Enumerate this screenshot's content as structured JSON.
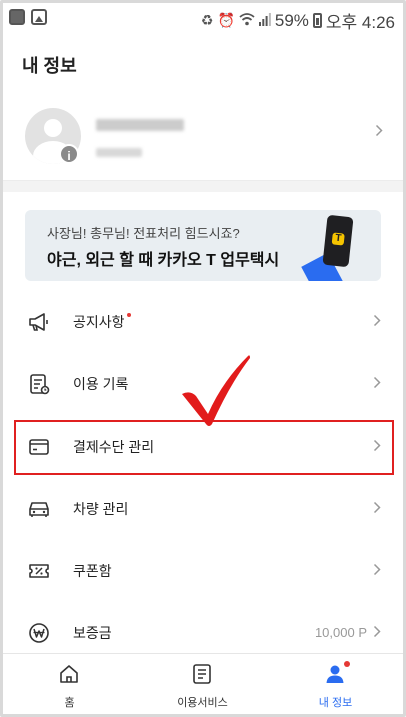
{
  "status_bar": {
    "battery": "59%",
    "time": "오후 4:26"
  },
  "header": {
    "title": "내 정보"
  },
  "banner": {
    "line1": "사장님! 총무님! 전표처리 힘드시죠?",
    "line2": "야근, 외근 할 때 카카오 T 업무택시",
    "phone_glyph": "T"
  },
  "menu": {
    "items": [
      {
        "label": "공지사항",
        "icon": "megaphone-icon",
        "new": true
      },
      {
        "label": "이용 기록",
        "icon": "receipt-icon"
      },
      {
        "label": "결제수단 관리",
        "icon": "card-icon",
        "highlighted": true
      },
      {
        "label": "차량 관리",
        "icon": "car-icon"
      },
      {
        "label": "쿠폰함",
        "icon": "coupon-icon"
      },
      {
        "label": "보증금",
        "icon": "won-icon",
        "value": "10,000 P"
      }
    ]
  },
  "bottom_nav": {
    "items": [
      {
        "label": "홈",
        "icon": "home-icon"
      },
      {
        "label": "이용서비스",
        "icon": "list-icon"
      },
      {
        "label": "내 정보",
        "icon": "person-icon",
        "active": true
      }
    ]
  },
  "colors": {
    "accent": "#2a6cf0",
    "highlight": "#e02020",
    "notification": "#e53935",
    "check": "#e21b1b"
  },
  "profile": {
    "info_badge": "i"
  }
}
